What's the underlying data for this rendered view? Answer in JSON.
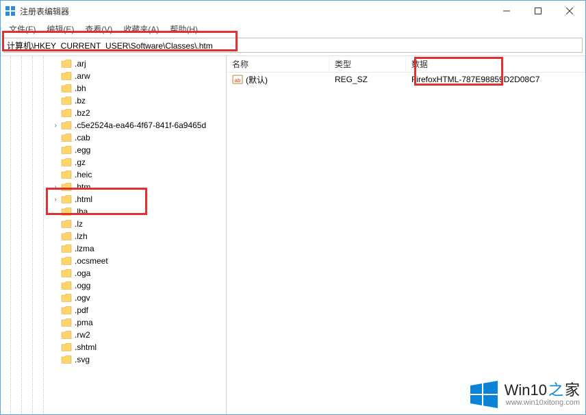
{
  "window": {
    "title": "注册表编辑器"
  },
  "menu": {
    "items": [
      "文件(F)",
      "编辑(E)",
      "查看(V)",
      "收藏夹(A)",
      "帮助(H)"
    ]
  },
  "addressbar": {
    "path": "计算机\\HKEY_CURRENT_USER\\Software\\Classes\\.htm"
  },
  "tree": {
    "items": [
      {
        "label": ".arj",
        "expandable": false
      },
      {
        "label": ".arw",
        "expandable": false
      },
      {
        "label": ".bh",
        "expandable": false
      },
      {
        "label": ".bz",
        "expandable": false
      },
      {
        "label": ".bz2",
        "expandable": false
      },
      {
        "label": ".c5e2524a-ea46-4f67-841f-6a9465d",
        "expandable": true
      },
      {
        "label": ".cab",
        "expandable": false
      },
      {
        "label": ".egg",
        "expandable": false
      },
      {
        "label": ".gz",
        "expandable": false
      },
      {
        "label": ".heic",
        "expandable": false
      },
      {
        "label": ".htm",
        "expandable": true
      },
      {
        "label": ".html",
        "expandable": true
      },
      {
        "label": ".lha",
        "expandable": false
      },
      {
        "label": ".lz",
        "expandable": false
      },
      {
        "label": ".lzh",
        "expandable": false
      },
      {
        "label": ".lzma",
        "expandable": false
      },
      {
        "label": ".ocsmeet",
        "expandable": false
      },
      {
        "label": ".oga",
        "expandable": false
      },
      {
        "label": ".ogg",
        "expandable": false
      },
      {
        "label": ".ogv",
        "expandable": false
      },
      {
        "label": ".pdf",
        "expandable": false
      },
      {
        "label": ".pma",
        "expandable": false
      },
      {
        "label": ".rw2",
        "expandable": false
      },
      {
        "label": ".shtml",
        "expandable": false
      },
      {
        "label": ".svg",
        "expandable": false
      }
    ]
  },
  "list": {
    "columns": {
      "name": "名称",
      "type": "类型",
      "data": "数据"
    },
    "rows": [
      {
        "name": "(默认)",
        "type": "REG_SZ",
        "data": "FirefoxHTML-787E98859D2D08C7"
      }
    ]
  },
  "watermark": {
    "brand_a": "Win10",
    "brand_b": "之",
    "brand_c": "家",
    "url": "www.win10xitong.com"
  }
}
